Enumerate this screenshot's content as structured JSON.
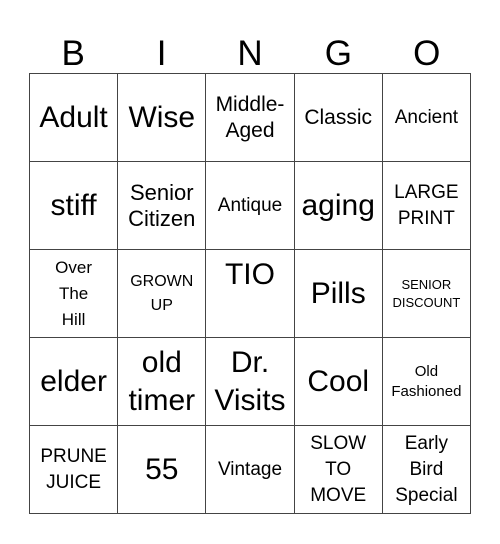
{
  "header": {
    "letters": [
      "B",
      "I",
      "N",
      "G",
      "O"
    ]
  },
  "card": {
    "rows": [
      [
        "Adult",
        "Wise",
        "Middle-\nAged",
        "Classic",
        "Ancient"
      ],
      [
        "stiff",
        "Senior\nCitizen",
        "Antique",
        "aging",
        "LARGE\nPRINT"
      ],
      [
        "Over\nThe\nHill",
        "GROWN\nUP",
        "TIO",
        "Pills",
        "SENIOR\nDISCOUNT"
      ],
      [
        "elder",
        "old\ntimer",
        "Dr.\nVisits",
        "Cool",
        "Old\nFashioned"
      ],
      [
        "PRUNE\nJUICE",
        "55",
        "Vintage",
        "SLOW\nTO\nMOVE",
        "Early\nBird\nSpecial"
      ]
    ]
  },
  "colors": {
    "text": "#000000",
    "grid_line": "#444444",
    "background": "#ffffff"
  }
}
